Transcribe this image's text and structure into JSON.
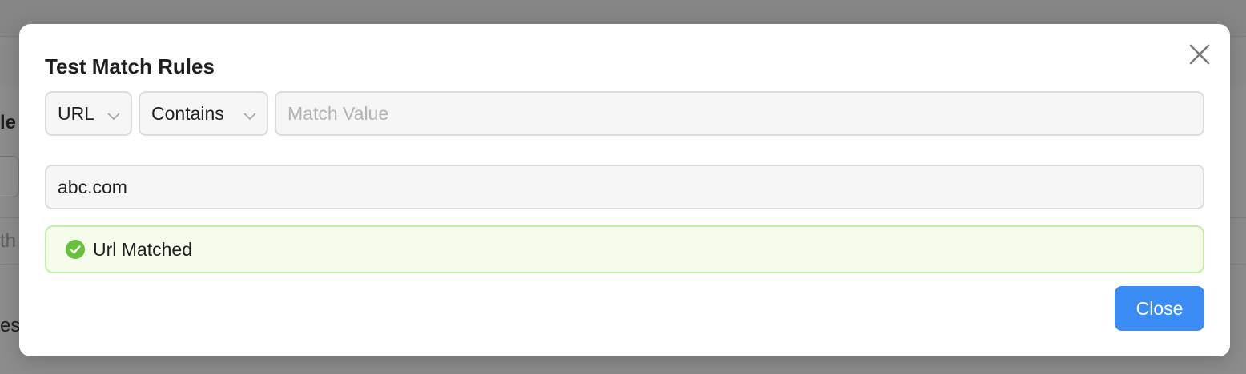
{
  "background": {
    "fragment_top": "le",
    "fragment_middle": "th",
    "fragment_bottom": "est"
  },
  "modal": {
    "title": "Test Match Rules",
    "close_icon": "close-icon",
    "field_select": {
      "value": "URL",
      "icon": "chevron-down-icon"
    },
    "operator_select": {
      "value": "Contains",
      "icon": "chevron-down-icon"
    },
    "match_value": {
      "value": "",
      "placeholder": "Match Value"
    },
    "test_url": {
      "value": "abc.com"
    },
    "result": {
      "icon": "check-circle-icon",
      "text": "Url Matched",
      "color": "#67c23a"
    },
    "close_button": {
      "label": "Close",
      "color": "#3b8cf5"
    }
  }
}
